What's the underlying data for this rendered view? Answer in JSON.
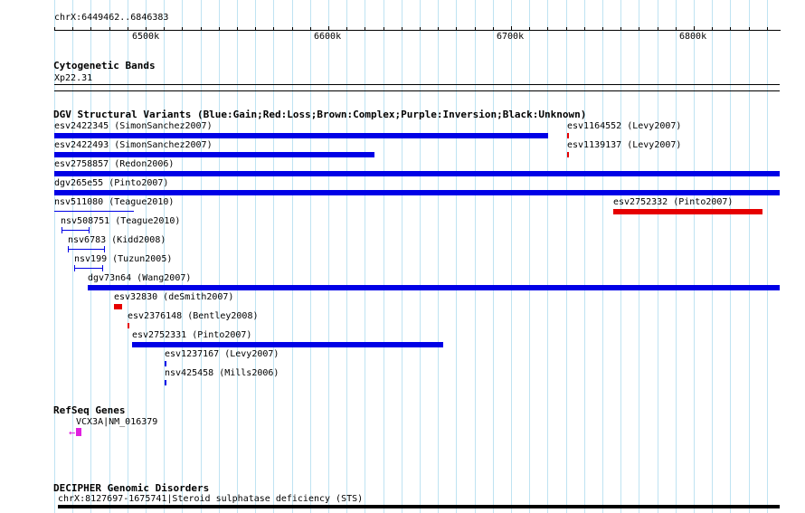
{
  "ruler": {
    "position": "chrX:6449462..6846383",
    "labels": [
      "6500k",
      "6600k",
      "6700k",
      "6800k"
    ]
  },
  "cytobands": {
    "title": "Cytogenetic Bands",
    "band": "Xp22.31"
  },
  "dgv": {
    "title": "DGV Structural Variants (Blue:Gain;Red:Loss;Brown:Complex;Purple:Inversion;Black:Unknown)",
    "colors": {
      "gain": "#0000e6",
      "loss": "#e60000"
    },
    "features": [
      {
        "label": "esv2422345 (SimonSanchez2007)",
        "type": "gain"
      },
      {
        "label": "esv1164552 (Levy2007)",
        "type": "loss"
      },
      {
        "label": "esv2422493 (SimonSanchez2007)",
        "type": "gain"
      },
      {
        "label": "esv1139137 (Levy2007)",
        "type": "loss"
      },
      {
        "label": "esv2758857 (Redon2006)",
        "type": "gain"
      },
      {
        "label": "dgv265e55 (Pinto2007)",
        "type": "gain"
      },
      {
        "label": "nsv511080 (Teague2010)",
        "type": "gain"
      },
      {
        "label": "esv2752332 (Pinto2007)",
        "type": "loss"
      },
      {
        "label": "nsv508751 (Teague2010)",
        "type": "gain"
      },
      {
        "label": "nsv6783 (Kidd2008)",
        "type": "gain"
      },
      {
        "label": "nsv199 (Tuzun2005)",
        "type": "gain"
      },
      {
        "label": "dgv73n64 (Wang2007)",
        "type": "gain"
      },
      {
        "label": "esv32830 (deSmith2007)",
        "type": "loss"
      },
      {
        "label": "esv2376148 (Bentley2008)",
        "type": "loss"
      },
      {
        "label": "esv2752331 (Pinto2007)",
        "type": "gain"
      },
      {
        "label": "esv1237167 (Levy2007)",
        "type": "gain"
      },
      {
        "label": "nsv425458 (Mills2006)",
        "type": "gain"
      }
    ]
  },
  "refseq": {
    "title": "RefSeq Genes",
    "gene": "VCX3A|NM_016379",
    "strand_icon": "left-arrow-icon",
    "color": "#e020e0"
  },
  "decipher": {
    "title": "DECIPHER Genomic Disorders",
    "feature": "chrX:8127697-1675741|Steroid sulphatase deficiency (STS)"
  }
}
